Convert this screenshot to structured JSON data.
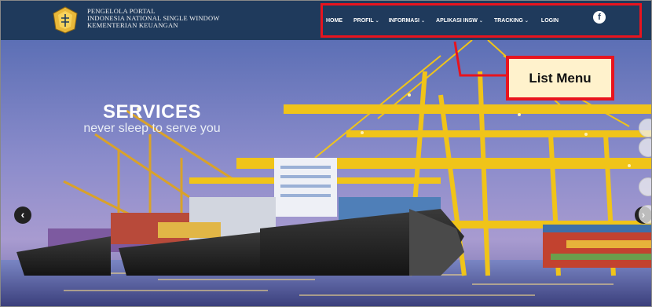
{
  "header": {
    "brand_lines": [
      "PENGELOLA PORTAL",
      "INDONESIA NATIONAL SINGLE WINDOW",
      "KEMENTERIAN KEUANGAN"
    ],
    "facebook_label": "f"
  },
  "nav": {
    "items": [
      {
        "label": "HOME"
      },
      {
        "label": "PROFIL"
      },
      {
        "label": "INFORMASI"
      },
      {
        "label": "APLIKASI INSW"
      },
      {
        "label": "TRACKING"
      },
      {
        "label": "LOGIN"
      }
    ]
  },
  "hero": {
    "title": "SERVICES",
    "subtitle": "never sleep to serve you",
    "prev_label": "‹",
    "next_label": "›"
  },
  "annotation": {
    "callout_label": "List Menu",
    "highlight_color": "#e8141e",
    "callout_fill": "#fff2cc"
  },
  "colors": {
    "header_bg": "#1f3a5c",
    "crane_yellow": "#f0c419"
  }
}
